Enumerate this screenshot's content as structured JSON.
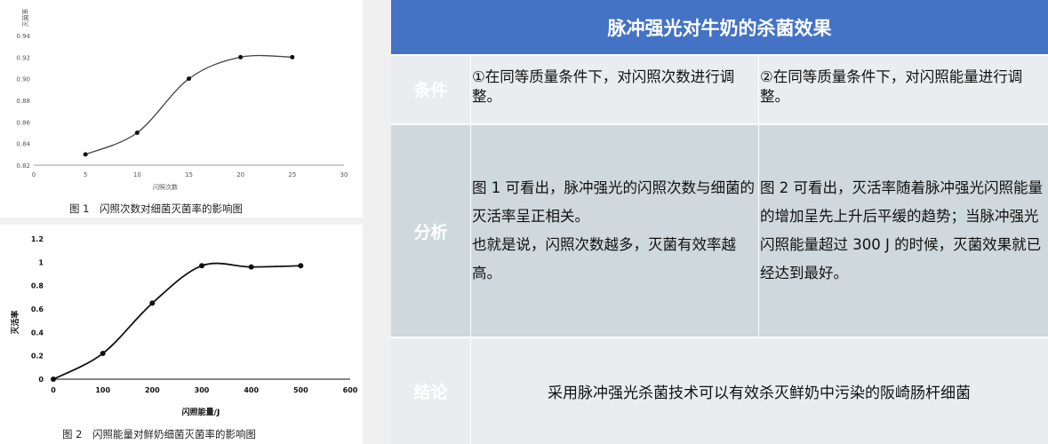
{
  "figure1": {
    "caption": "图 1　闪照次数对细菌灭菌率的影响图"
  },
  "figure2": {
    "caption": "图 2　闪照能量对鲜奶细菌灭菌率的影响图"
  },
  "table": {
    "title": "脉冲强光对牛奶的杀菌效果",
    "rows": [
      {
        "header": "条件",
        "col1": "①在同等质量条件下，对闪照次数进行调整。",
        "col2": "②在同等质量条件下，对闪照能量进行调整。"
      },
      {
        "header": "分析",
        "col1_p1": "图 1 可看出，脉冲强光的闪照次数与细菌的灭活率呈正相关。",
        "col1_p2": "也就是说，闪照次数越多，灭菌有效率越高。",
        "col2": "图 2 可看出，灭活率随着脉冲强光闪照能量的增加呈先上升后平缓的趋势；当脉冲强光闪照能量超过 300 J 的时候，灭菌效果就已经达到最好。"
      },
      {
        "header": "结论",
        "text": "采用脉冲强光杀菌技术可以有效杀灭鲜奶中污染的阪崎肠杆细菌"
      }
    ]
  },
  "colors": {
    "header_blue": "#4472c4",
    "row_light": "#e9edf0",
    "row_mid": "#cfd8dc"
  },
  "chart_data": [
    {
      "type": "line",
      "title": "",
      "xlabel": "闪照次数",
      "ylabel": "灭菌率",
      "x": [
        5,
        10,
        15,
        20,
        25
      ],
      "y": [
        0.83,
        0.85,
        0.9,
        0.92,
        0.92
      ],
      "xlim": [
        0,
        30
      ],
      "ylim": [
        0.82,
        0.94
      ],
      "xticks": [
        "0",
        "5",
        "10",
        "15",
        "20",
        "25",
        "30"
      ],
      "yticks": [
        "0.82",
        "0.84",
        "0.86",
        "0.88",
        "0.90",
        "0.92",
        "0.94"
      ],
      "grid": false,
      "smooth": true
    },
    {
      "type": "line",
      "title": "",
      "xlabel": "闪照能量/J",
      "ylabel": "灭活率",
      "x": [
        0,
        100,
        200,
        300,
        400,
        500
      ],
      "y": [
        0,
        0.22,
        0.65,
        0.97,
        0.96,
        0.97
      ],
      "xlim": [
        0,
        600
      ],
      "ylim": [
        0,
        1.2
      ],
      "xticks": [
        "0",
        "100",
        "200",
        "300",
        "400",
        "500",
        "600"
      ],
      "yticks": [
        "0",
        "0.2",
        "0.4",
        "0.6",
        "0.8",
        "1",
        "1.2"
      ],
      "grid": false,
      "smooth": true
    }
  ]
}
